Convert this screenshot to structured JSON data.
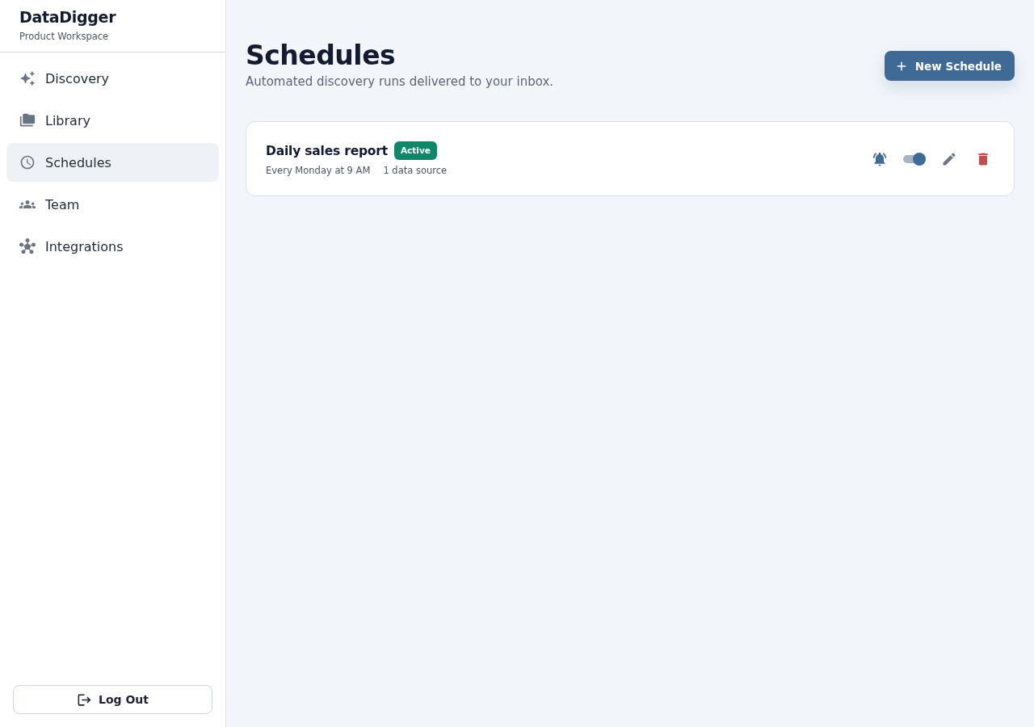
{
  "sidebar": {
    "brand": "DataDigger",
    "workspace": "Product Workspace",
    "items": [
      {
        "label": "Discovery",
        "selected": false
      },
      {
        "label": "Library",
        "selected": false
      },
      {
        "label": "Schedules",
        "selected": true
      },
      {
        "label": "Team",
        "selected": false
      },
      {
        "label": "Integrations",
        "selected": false
      }
    ],
    "logout": "Log Out"
  },
  "header": {
    "title": "Schedules",
    "subtitle": "Automated discovery runs delivered to your inbox.",
    "new_button": "New Schedule"
  },
  "schedules": [
    {
      "name": "Daily sales report",
      "status": "Active",
      "active": true,
      "frequency": "Every Monday at 9 AM",
      "sources": "1 data source",
      "notifications": true,
      "enabled": true
    }
  ]
}
